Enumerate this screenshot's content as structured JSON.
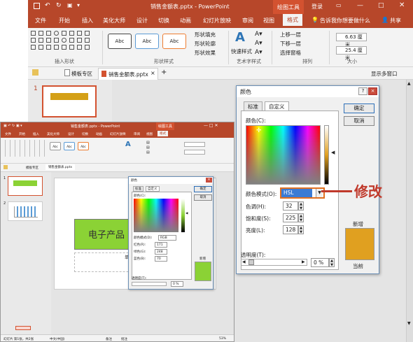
{
  "big_window": {
    "title": "销售金额表.pptx - PowerPoint",
    "context_tab": "绘图工具",
    "account": "登录",
    "tabs": [
      "文件",
      "开始",
      "插入",
      "美化大师",
      "设计",
      "切换",
      "动画",
      "幻灯片放映",
      "审阅",
      "视图",
      "格式"
    ],
    "active_tab": "格式",
    "tell_me": "告诉我你想要做什么",
    "share": "共享",
    "ribbon": {
      "group_insert_shapes": "插入形状",
      "group_shape_styles": "形状样式",
      "group_wordart": "艺术字样式",
      "group_arrange": "排列",
      "group_size": "大小",
      "style_buttons": [
        "Abc",
        "Abc",
        "Abc"
      ],
      "shape_fill": "形状填充",
      "shape_outline": "形状轮廓",
      "shape_effects": "形状效果",
      "quick_styles": "快速样式",
      "bring_forward": "上移一层",
      "send_backward": "下移一层",
      "selection_pane": "选择窗格",
      "height": "6.63 厘米",
      "width": "25.4 厘米"
    },
    "doc_tabs": [
      "模板专区",
      "销售金额表.pptx"
    ],
    "show_pane": "显示多窗口",
    "slide_number": "1"
  },
  "color_dialog": {
    "title": "颜色",
    "help": "?",
    "close": "×",
    "tabs": [
      "标准",
      "自定义"
    ],
    "active_tab": "自定义",
    "colors_label": "颜色(C):",
    "ok": "确定",
    "cancel": "取消",
    "color_model_label": "颜色模式(O):",
    "color_model_value": "HSL",
    "hue_label": "色调(H):",
    "hue": "32",
    "saturation_label": "饱和度(S):",
    "saturation": "225",
    "lightness_label": "亮度(L):",
    "lightness": "128",
    "transparency_label": "透明度(T):",
    "transparency": "0 %",
    "new_label": "新增",
    "current_label": "当前",
    "new_color": "#e0a020"
  },
  "small_window": {
    "title": "销售金额表.pptx - PowerPoint",
    "context_tab": "绘图工具",
    "tabs": [
      "文件",
      "开始",
      "插入",
      "美化大师",
      "设计",
      "切换",
      "动画",
      "幻灯片放映",
      "审阅",
      "视图",
      "格式"
    ],
    "doc_tabs": [
      "模板专区",
      "销售金额表.pptx"
    ],
    "slide_text": "电子产品",
    "slide_subtext": "单",
    "thumb_numbers": [
      "1",
      "2"
    ],
    "status_left": "幻灯片 第1张，共2张",
    "status_lang": "中文(中国)",
    "status_right": [
      "备注",
      "批注"
    ],
    "zoom": "53%"
  },
  "small_dialog": {
    "title": "颜色",
    "tabs": [
      "标准",
      "自定义"
    ],
    "colors_label": "颜色(C):",
    "ok": "确定",
    "cancel": "取消",
    "color_model_label": "颜色模式(D):",
    "color_model_value": "RGB",
    "red_label": "红色(R):",
    "red": "171",
    "green_label": "绿色(G):",
    "green": "248",
    "blue_label": "蓝色(B):",
    "blue": "70",
    "transparency_label": "透明度(T):",
    "transparency": "0 %",
    "new_label": "新增",
    "current_label": "当前",
    "new_color": "#8bd235"
  },
  "annotation": {
    "callout": "修改",
    "accent": "#c0392b"
  },
  "colors": {
    "ppt_accent": "#b7472a",
    "title_box": "#d4a017",
    "green_box": "#8bd235"
  }
}
